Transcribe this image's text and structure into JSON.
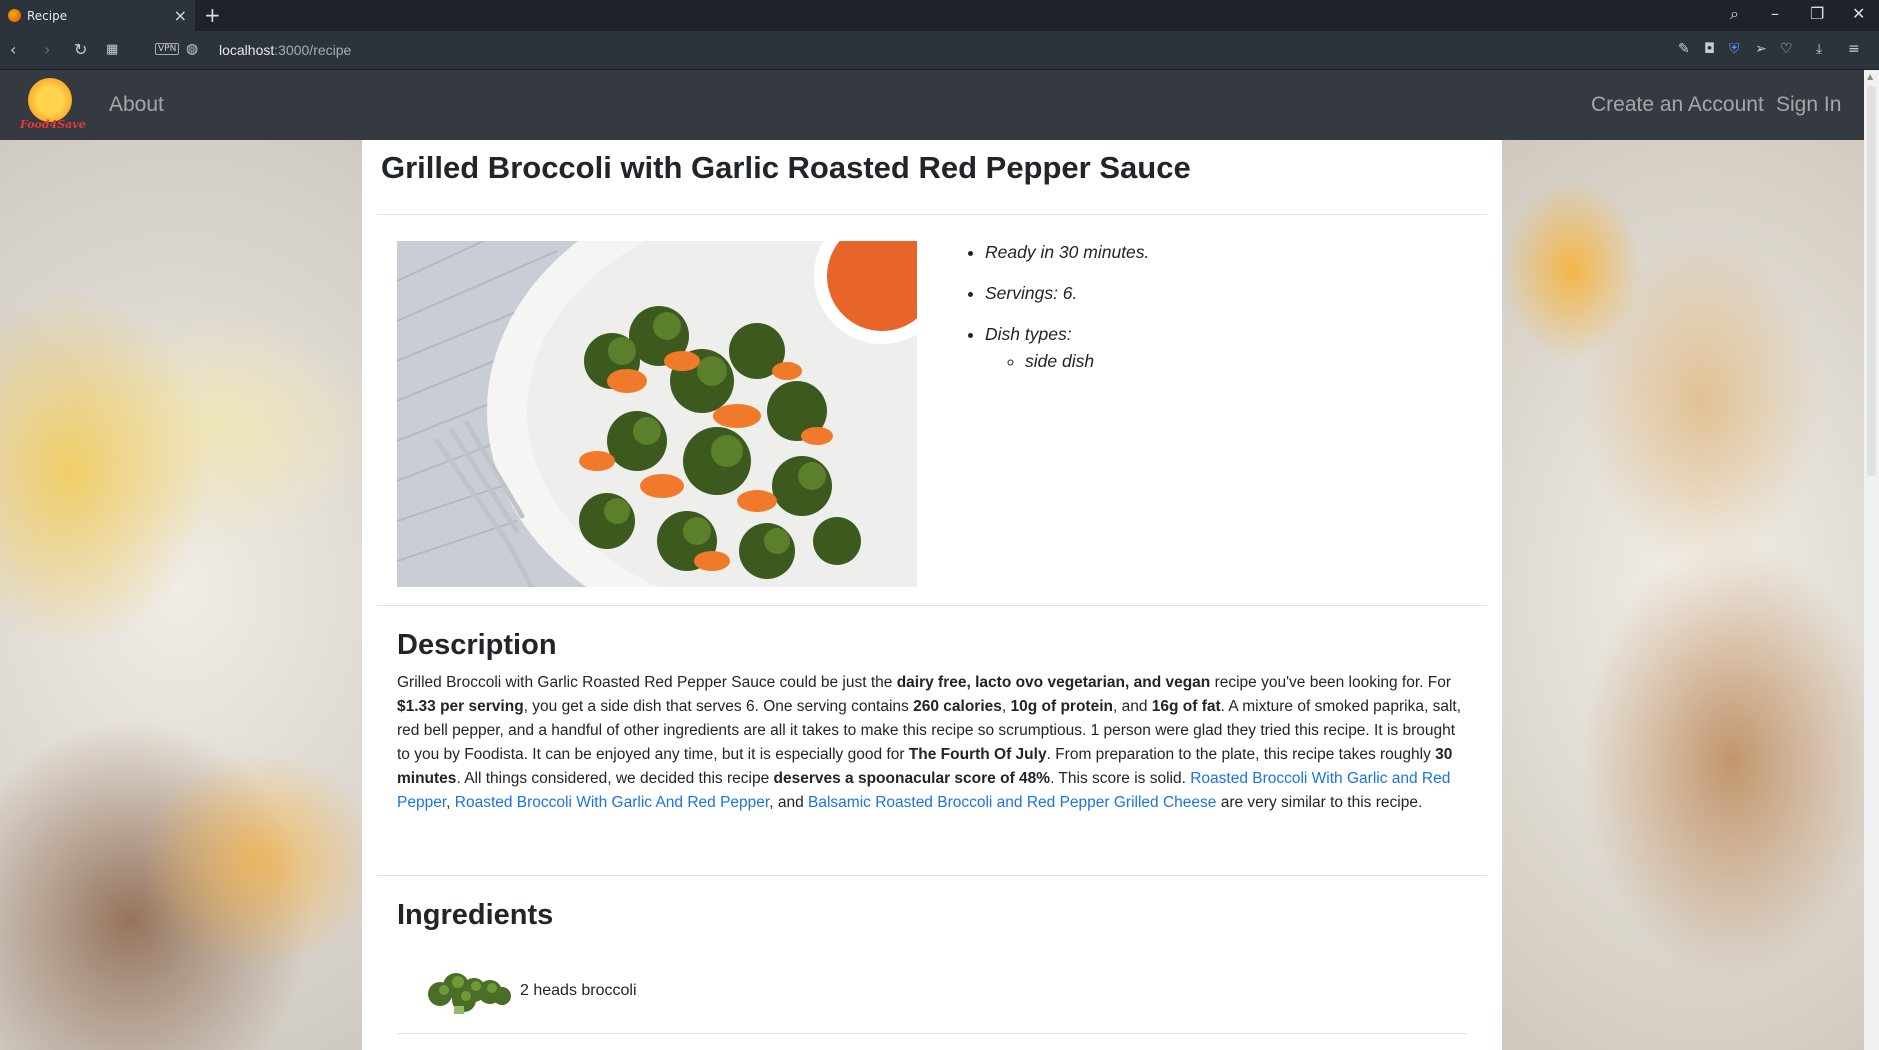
{
  "browser": {
    "tab_title": "Recipe",
    "url_host": "localhost",
    "url_path": ":3000/recipe",
    "vpn_label": "VPN"
  },
  "navbar": {
    "logo_text": "Food4Save",
    "about": "About",
    "create_account": "Create an Account",
    "sign_in": "Sign In"
  },
  "recipe": {
    "title": "Grilled Broccoli with Garlic Roasted Red Pepper Sauce",
    "facts": {
      "ready": "Ready in 30 minutes.",
      "servings": "Servings: 6.",
      "dish_types_label": "Dish types:",
      "dish_types": [
        "side dish"
      ]
    },
    "description_heading": "Description",
    "description": {
      "p1": "Grilled Broccoli with Garlic Roasted Red Pepper Sauce could be just the ",
      "b1": "dairy free, lacto ovo vegetarian, and vegan",
      "p2": " recipe you've been looking for. For ",
      "b2": "$1.33 per serving",
      "p3": ", you get a side dish that serves 6. One serving contains ",
      "b3": "260 calories",
      "p4": ", ",
      "b4": "10g of protein",
      "p5": ", and ",
      "b5": "16g of fat",
      "p6": ". A mixture of smoked paprika, salt, red bell pepper, and a handful of other ingredients are all it takes to make this recipe so scrumptious. 1 person were glad they tried this recipe. It is brought to you by Foodista. It can be enjoyed any time, but it is especially good for ",
      "b6": "The Fourth Of July",
      "p7": ". From preparation to the plate, this recipe takes roughly ",
      "b7": "30 minutes",
      "p8": ". All things considered, we decided this recipe ",
      "b8": "deserves a spoonacular score of 48%",
      "p9": ". This score is solid. ",
      "link1": "Roasted Broccoli With Garlic and Red Pepper",
      "p10": ", ",
      "link2": "Roasted Broccoli With Garlic And Red Pepper",
      "p11": ", and ",
      "link3": "Balsamic Roasted Broccoli and Red Pepper Grilled Cheese",
      "p12": " are very similar to this recipe."
    },
    "ingredients_heading": "Ingredients",
    "ingredients": [
      {
        "text": "2 heads broccoli",
        "icon": "broccoli-icon"
      }
    ]
  },
  "colors": {
    "navbar": "#343a40",
    "link": "#1a73e8"
  }
}
